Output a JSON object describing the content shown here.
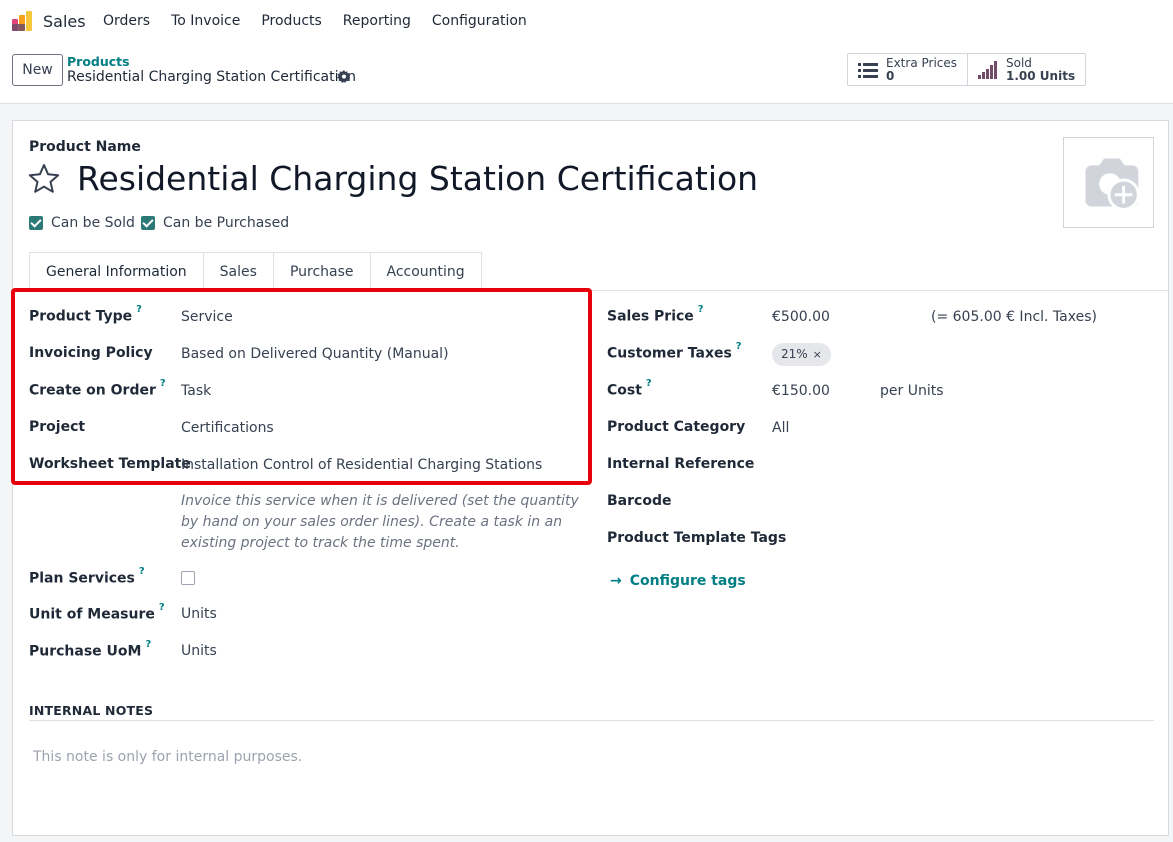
{
  "navbar": {
    "app_name": "Sales",
    "menu": [
      "Orders",
      "To Invoice",
      "Products",
      "Reporting",
      "Configuration"
    ]
  },
  "control_panel": {
    "new_label": "New",
    "breadcrumb_parent": "Products",
    "breadcrumb_current": "Residential Charging Station Certification",
    "smart_buttons": [
      {
        "label": "Extra Prices",
        "value": "0",
        "icon": "list-icon"
      },
      {
        "label": "Sold",
        "value": "1.00 Units",
        "icon": "signal-bars-icon"
      }
    ]
  },
  "form": {
    "product_name_label": "Product Name",
    "product_name": "Residential Charging Station Certification",
    "can_be_sold_label": "Can be Sold",
    "can_be_purchased_label": "Can be Purchased",
    "tabs": [
      "General Information",
      "Sales",
      "Purchase",
      "Accounting"
    ],
    "left_fields": {
      "product_type": {
        "label": "Product Type",
        "help": "?",
        "value": "Service"
      },
      "invoicing_policy": {
        "label": "Invoicing Policy",
        "value": "Based on Delivered Quantity (Manual)"
      },
      "create_on_order": {
        "label": "Create on Order",
        "help": "?",
        "value": "Task"
      },
      "project": {
        "label": "Project",
        "value": "Certifications"
      },
      "worksheet_template": {
        "label": "Worksheet Template",
        "value": "Installation Control of Residential Charging Stations"
      },
      "help_text": "Invoice this service when it is delivered (set the quantity by hand on your sales order lines). Create a task in an existing project to track the time spent.",
      "plan_services": {
        "label": "Plan Services",
        "help": "?"
      },
      "unit_of_measure": {
        "label": "Unit of Measure",
        "help": "?",
        "value": "Units"
      },
      "purchase_uom": {
        "label": "Purchase UoM",
        "help": "?",
        "value": "Units"
      }
    },
    "right_fields": {
      "sales_price": {
        "label": "Sales Price",
        "help": "?",
        "value": "€500.00",
        "incl_taxes": "(= 605.00 € Incl. Taxes)"
      },
      "customer_taxes": {
        "label": "Customer Taxes",
        "help": "?",
        "tag": "21%",
        "remove": "×"
      },
      "cost": {
        "label": "Cost",
        "help": "?",
        "value": "€150.00",
        "unit": "per Units"
      },
      "product_category": {
        "label": "Product Category",
        "value": "All"
      },
      "internal_reference": {
        "label": "Internal Reference"
      },
      "barcode": {
        "label": "Barcode"
      },
      "product_template_tags": {
        "label": "Product Template Tags"
      },
      "configure_tags": "Configure tags"
    },
    "notes": {
      "heading": "INTERNAL NOTES",
      "placeholder": "This note is only for internal purposes."
    }
  },
  "colors": {
    "accent": "#017e84",
    "highlight": "#e8000a",
    "checkbox": "#2b7a78",
    "brand": "#714b67"
  }
}
